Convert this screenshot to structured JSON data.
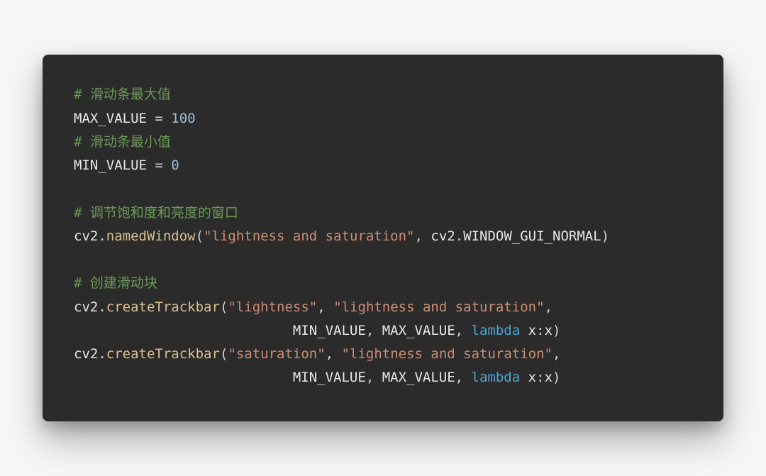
{
  "code": {
    "lines": [
      {
        "indent": 0,
        "tokens": [
          {
            "cls": "tok-comment",
            "text": "# 滑动条最大值"
          }
        ]
      },
      {
        "indent": 0,
        "tokens": [
          {
            "cls": "tok-ident",
            "text": "MAX_VALUE"
          },
          {
            "cls": "tok-op",
            "text": " = "
          },
          {
            "cls": "tok-number",
            "text": "100"
          }
        ]
      },
      {
        "indent": 0,
        "tokens": [
          {
            "cls": "tok-comment",
            "text": "# 滑动条最小值"
          }
        ]
      },
      {
        "indent": 0,
        "tokens": [
          {
            "cls": "tok-ident",
            "text": "MIN_VALUE"
          },
          {
            "cls": "tok-op",
            "text": " = "
          },
          {
            "cls": "tok-number",
            "text": "0"
          }
        ]
      },
      {
        "indent": 0,
        "tokens": []
      },
      {
        "indent": 0,
        "tokens": [
          {
            "cls": "tok-comment",
            "text": "# 调节饱和度和亮度的窗口"
          }
        ]
      },
      {
        "indent": 0,
        "tokens": [
          {
            "cls": "tok-ident",
            "text": "cv2"
          },
          {
            "cls": "tok-punct",
            "text": "."
          },
          {
            "cls": "tok-call",
            "text": "namedWindow"
          },
          {
            "cls": "tok-punct",
            "text": "("
          },
          {
            "cls": "tok-string",
            "text": "\"lightness and saturation\""
          },
          {
            "cls": "tok-punct",
            "text": ", "
          },
          {
            "cls": "tok-ident",
            "text": "cv2"
          },
          {
            "cls": "tok-punct",
            "text": "."
          },
          {
            "cls": "tok-ident",
            "text": "WINDOW_GUI_NORMAL"
          },
          {
            "cls": "tok-punct",
            "text": ")"
          }
        ]
      },
      {
        "indent": 0,
        "tokens": []
      },
      {
        "indent": 0,
        "tokens": [
          {
            "cls": "tok-comment",
            "text": "# 创建滑动块"
          }
        ]
      },
      {
        "indent": 0,
        "tokens": [
          {
            "cls": "tok-ident",
            "text": "cv2"
          },
          {
            "cls": "tok-punct",
            "text": "."
          },
          {
            "cls": "tok-call",
            "text": "createTrackbar"
          },
          {
            "cls": "tok-punct",
            "text": "("
          },
          {
            "cls": "tok-string",
            "text": "\"lightness\""
          },
          {
            "cls": "tok-punct",
            "text": ", "
          },
          {
            "cls": "tok-string",
            "text": "\"lightness and saturation\""
          },
          {
            "cls": "tok-punct",
            "text": ","
          }
        ]
      },
      {
        "indent": 27,
        "tokens": [
          {
            "cls": "tok-ident",
            "text": "MIN_VALUE"
          },
          {
            "cls": "tok-punct",
            "text": ", "
          },
          {
            "cls": "tok-ident",
            "text": "MAX_VALUE"
          },
          {
            "cls": "tok-punct",
            "text": ", "
          },
          {
            "cls": "tok-keyword",
            "text": "lambda"
          },
          {
            "cls": "tok-param",
            "text": " x"
          },
          {
            "cls": "tok-punct",
            "text": ":"
          },
          {
            "cls": "tok-ident",
            "text": "x"
          },
          {
            "cls": "tok-punct",
            "text": ")"
          }
        ]
      },
      {
        "indent": 0,
        "tokens": [
          {
            "cls": "tok-ident",
            "text": "cv2"
          },
          {
            "cls": "tok-punct",
            "text": "."
          },
          {
            "cls": "tok-call",
            "text": "createTrackbar"
          },
          {
            "cls": "tok-punct",
            "text": "("
          },
          {
            "cls": "tok-string",
            "text": "\"saturation\""
          },
          {
            "cls": "tok-punct",
            "text": ", "
          },
          {
            "cls": "tok-string",
            "text": "\"lightness and saturation\""
          },
          {
            "cls": "tok-punct",
            "text": ","
          }
        ]
      },
      {
        "indent": 27,
        "tokens": [
          {
            "cls": "tok-ident",
            "text": "MIN_VALUE"
          },
          {
            "cls": "tok-punct",
            "text": ", "
          },
          {
            "cls": "tok-ident",
            "text": "MAX_VALUE"
          },
          {
            "cls": "tok-punct",
            "text": ", "
          },
          {
            "cls": "tok-keyword",
            "text": "lambda"
          },
          {
            "cls": "tok-param",
            "text": " x"
          },
          {
            "cls": "tok-punct",
            "text": ":"
          },
          {
            "cls": "tok-ident",
            "text": "x"
          },
          {
            "cls": "tok-punct",
            "text": ")"
          }
        ]
      }
    ]
  }
}
